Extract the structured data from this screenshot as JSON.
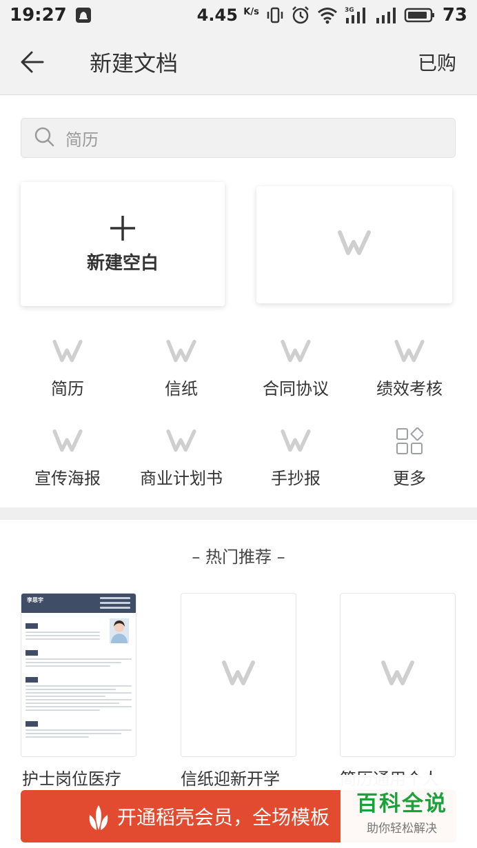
{
  "status_bar": {
    "time": "19:27",
    "speed": "4.45",
    "speed_unit": "K/s",
    "signal_type": "3G",
    "battery": "73",
    "icons": [
      "notification-icon",
      "vibrate-icon",
      "alarm-icon",
      "wifi-icon",
      "signal-3g-icon",
      "signal-icon",
      "battery-icon"
    ]
  },
  "header": {
    "title": "新建文档",
    "purchased": "已购",
    "back_icon": "back-arrow-icon"
  },
  "search": {
    "placeholder": "简历",
    "icon": "search-icon"
  },
  "new_blank": {
    "label": "新建空白",
    "icon": "plus-icon"
  },
  "categories": [
    {
      "label": "简历",
      "icon": "wps-logo-icon"
    },
    {
      "label": "信纸",
      "icon": "wps-logo-icon"
    },
    {
      "label": "合同协议",
      "icon": "wps-logo-icon"
    },
    {
      "label": "绩效考核",
      "icon": "wps-logo-icon"
    },
    {
      "label": "宣传海报",
      "icon": "wps-logo-icon"
    },
    {
      "label": "商业计划书",
      "icon": "wps-logo-icon"
    },
    {
      "label": "手抄报",
      "icon": "wps-logo-icon"
    },
    {
      "label": "更多",
      "icon": "grid-more-icon"
    }
  ],
  "hot": {
    "title": "– 热门推荐 –",
    "templates": [
      {
        "label": "护士岗位医疗",
        "resume_name": "李思宇"
      },
      {
        "label": "信纸迎新开学"
      },
      {
        "label": "简历通用个人"
      }
    ]
  },
  "vip": {
    "text": "开通稻壳会员，全场模板",
    "icon": "docer-leaf-icon"
  },
  "watermark": {
    "title": "百科全说",
    "subtitle": "助你轻松解决"
  },
  "colors": {
    "accent": "#e24b30",
    "header_bg": "#f2f2f2",
    "watermark_green": "#1aa23a",
    "resume_header": "#3f4d66"
  }
}
